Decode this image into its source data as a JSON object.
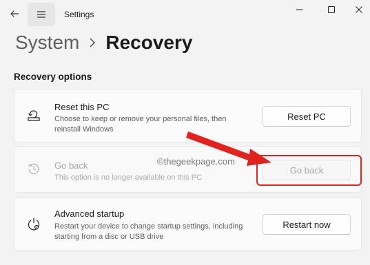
{
  "window": {
    "app_title": "Settings"
  },
  "breadcrumb": {
    "parent": "System",
    "current": "Recovery"
  },
  "section": {
    "title": "Recovery options"
  },
  "options": {
    "reset": {
      "title": "Reset this PC",
      "description": "Choose to keep or remove your personal files, then reinstall Windows",
      "button": "Reset PC"
    },
    "go_back": {
      "title": "Go back",
      "description": "This option is no longer available on this PC",
      "button": "Go back"
    },
    "advanced": {
      "title": "Advanced startup",
      "description": "Restart your device to change startup settings, including starting from a disc or USB drive",
      "button": "Restart now"
    }
  },
  "watermark": "©thegeekpage.com",
  "colors": {
    "annotation_red": "#e0231e"
  },
  "icons": {
    "back": "back-arrow-icon",
    "menu": "hamburger-menu-icon",
    "minimize": "minimize-icon",
    "maximize": "maximize-icon",
    "close": "close-icon",
    "breadcrumb_sep": "chevron-right-icon",
    "reset": "reset-pc-icon",
    "go_back": "history-icon",
    "advanced": "advanced-startup-icon"
  }
}
